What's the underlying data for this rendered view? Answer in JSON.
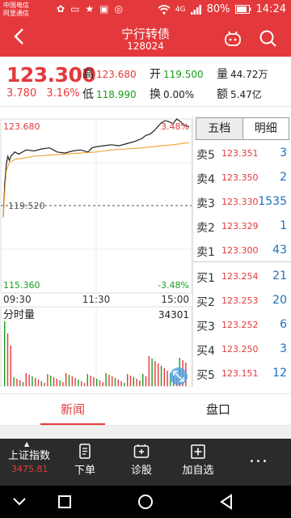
{
  "status_bar": {
    "carrier_line1": "中国电信",
    "carrier_line2": "阿里通信",
    "icons": [
      "flower-icon",
      "message-icon",
      "star-icon",
      "bell-icon",
      "wechat-icon"
    ],
    "network_4g": "4G",
    "battery": "80%",
    "time": "14:24"
  },
  "nav": {
    "title": "宁行转债",
    "code": "128024"
  },
  "quote": {
    "price": "123.300",
    "change": "3.780",
    "change_pct": "3.16%",
    "high_label": "高",
    "high": "123.680",
    "open_label": "开",
    "open": "119.500",
    "volume_label": "量",
    "volume": "44.72万",
    "low_label": "低",
    "low": "118.990",
    "turnover_label": "换",
    "turnover": "0.00%",
    "amount_label": "额",
    "amount": "5.47亿"
  },
  "chart_data": {
    "type": "line",
    "y_top_label": "123.680",
    "y_top_pct": "3.48%",
    "y_mid_label": "119.520",
    "y_bottom_label": "115.360",
    "y_bottom_pct": "-3.48%",
    "x_labels": [
      "09:30",
      "11:30",
      "15:00"
    ],
    "ylim": [
      115.36,
      123.68
    ],
    "prev_close": 119.52,
    "series": [
      {
        "x": [
          0,
          2,
          4,
          6,
          8,
          10,
          15,
          20,
          30,
          40,
          50,
          60,
          70,
          80,
          90,
          100,
          110,
          115,
          120,
          130,
          140,
          150,
          160,
          170,
          180,
          185,
          190,
          195,
          200,
          205,
          210,
          215,
          220,
          225,
          230,
          234,
          238,
          241
        ],
        "values": [
          118.99,
          120.6,
          121.5,
          121.9,
          121.7,
          121.9,
          122.1,
          122.0,
          122.2,
          122.15,
          122.25,
          122.3,
          122.1,
          122.05,
          122.15,
          122.2,
          122.1,
          122.3,
          122.35,
          122.4,
          122.45,
          122.4,
          122.5,
          122.6,
          122.75,
          122.9,
          122.95,
          123.1,
          123.3,
          123.5,
          123.6,
          123.55,
          123.45,
          123.68,
          123.55,
          123.4,
          123.35,
          123.3
        ]
      },
      {
        "x": [
          0,
          2,
          4,
          8,
          15,
          25,
          40,
          60,
          80,
          100,
          120,
          140,
          160,
          180,
          200,
          220,
          241
        ],
        "values": [
          118.99,
          120.2,
          121.2,
          121.6,
          121.75,
          121.8,
          121.9,
          121.95,
          122.0,
          122.05,
          122.1,
          122.2,
          122.25,
          122.3,
          122.38,
          122.45,
          122.55
        ]
      }
    ],
    "volume_title": "分时量",
    "volume_max": "34301"
  },
  "book": {
    "tabs": [
      "五档",
      "明细"
    ],
    "asks": [
      {
        "label": "卖5",
        "price": "123.351",
        "vol": "3"
      },
      {
        "label": "卖4",
        "price": "123.350",
        "vol": "2"
      },
      {
        "label": "卖3",
        "price": "123.330",
        "vol": "1535"
      },
      {
        "label": "卖2",
        "price": "123.329",
        "vol": "1"
      },
      {
        "label": "卖1",
        "price": "123.300",
        "vol": "43"
      }
    ],
    "bids": [
      {
        "label": "买1",
        "price": "123.254",
        "vol": "21"
      },
      {
        "label": "买2",
        "price": "123.253",
        "vol": "20"
      },
      {
        "label": "买3",
        "price": "123.252",
        "vol": "6"
      },
      {
        "label": "买4",
        "price": "123.250",
        "vol": "3"
      },
      {
        "label": "买5",
        "price": "123.151",
        "vol": "12"
      }
    ]
  },
  "bottom_tabs": [
    "新闻",
    "盘口"
  ],
  "toolbar": {
    "index_name": "上证指数",
    "index_value": "3475.81",
    "items": [
      {
        "label": "下单",
        "icon": "document-icon"
      },
      {
        "label": "诊股",
        "icon": "stethoscope-icon"
      },
      {
        "label": "加自选",
        "icon": "add-box-icon"
      }
    ],
    "more": "..."
  },
  "colors": {
    "accent": "#e4393c",
    "down": "#1a9e1a",
    "book_volume": "#1f6fbf",
    "toolbar_bg": "#2b2b2b"
  }
}
